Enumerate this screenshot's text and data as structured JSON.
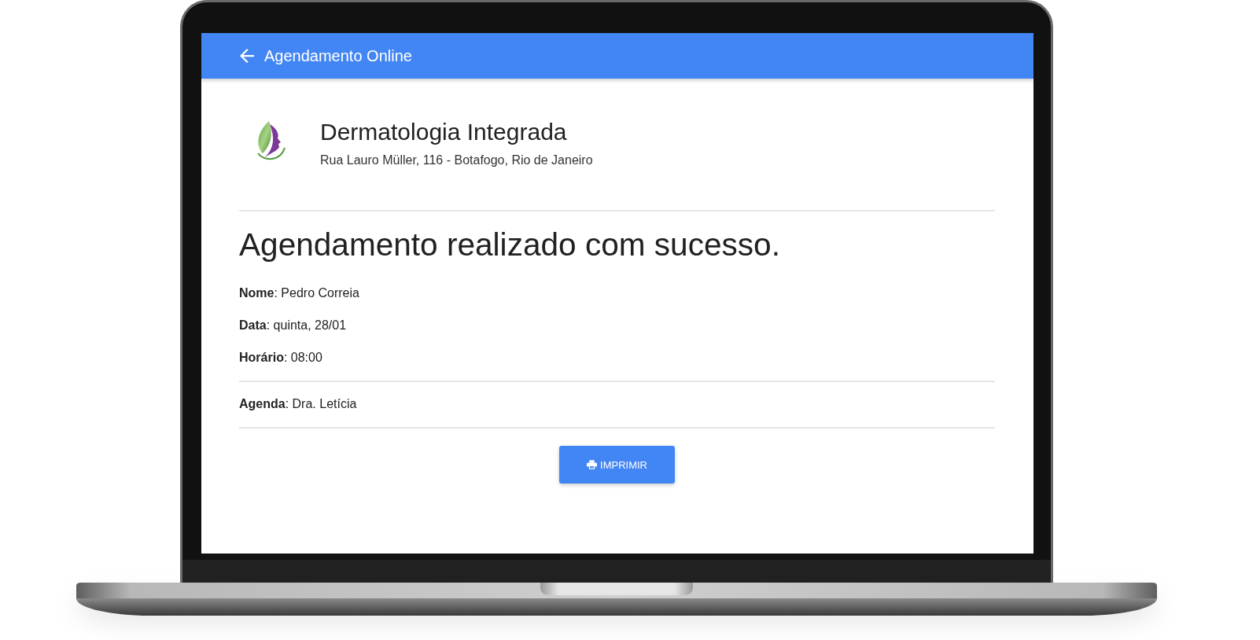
{
  "app_bar": {
    "title": "Agendamento Online"
  },
  "clinic": {
    "name": "Dermatologia Integrada",
    "address": "Rua Lauro Müller, 116 - Botafogo, Rio de Janeiro"
  },
  "heading": "Agendamento realizado com sucesso.",
  "details": [
    "**Nome**: Pedro Correia",
    "**Data**: quinta, 28/01",
    "**Horário**: 08:00"
  ],
  "agenda": "**Agenda**: Dra. Letícia",
  "print_button": {
    "label": "IMPRIMIR"
  }
}
